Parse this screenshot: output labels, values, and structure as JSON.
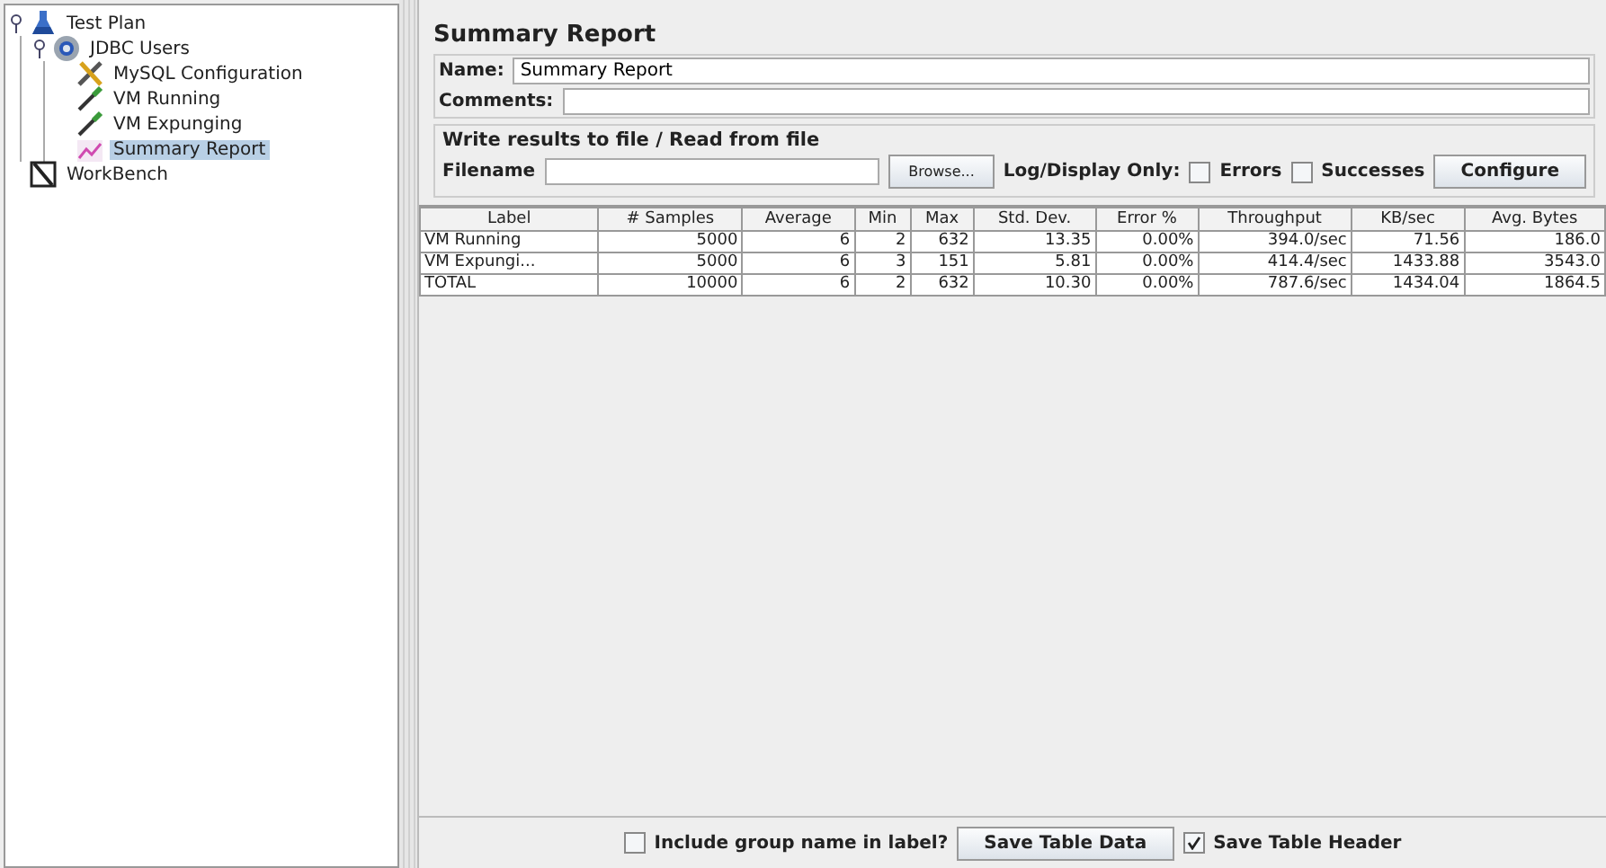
{
  "tree": [
    {
      "label": "Test Plan",
      "kind": "testplan",
      "selected": false,
      "expanded": true,
      "children": [
        {
          "label": "JDBC Users",
          "kind": "threadgroup",
          "selected": false,
          "expanded": true,
          "children": [
            {
              "label": "MySQL Configuration",
              "kind": "config",
              "selected": false
            },
            {
              "label": "VM Running",
              "kind": "sampler",
              "selected": false
            },
            {
              "label": "VM Expunging",
              "kind": "sampler",
              "selected": false
            },
            {
              "label": "Summary Report",
              "kind": "listener",
              "selected": true
            }
          ]
        }
      ]
    },
    {
      "label": "WorkBench",
      "kind": "workbench",
      "selected": false
    }
  ],
  "panel": {
    "title": "Summary Report",
    "name_label": "Name:",
    "name_value": "Summary Report",
    "comments_label": "Comments:",
    "file_group": {
      "title": "Write results to file / Read from file",
      "filename_label": "Filename",
      "browse": "Browse...",
      "log_label": "Log/Display Only:",
      "checks": [
        {
          "label": "Errors",
          "checked": false
        },
        {
          "label": "Successes",
          "checked": false
        }
      ],
      "configure": "Configure"
    }
  },
  "table": {
    "columns": [
      "Label",
      "# Samples",
      "Average",
      "Min",
      "Max",
      "Std. Dev.",
      "Error %",
      "Throughput",
      "KB/sec",
      "Avg. Bytes"
    ],
    "rows": [
      [
        "VM Running",
        "5000",
        "6",
        "2",
        "632",
        "13.35",
        "0.00%",
        "394.0/sec",
        "71.56",
        "186.0"
      ],
      [
        "VM Expungi...",
        "5000",
        "6",
        "3",
        "151",
        "5.81",
        "0.00%",
        "414.4/sec",
        "1433.88",
        "3543.0"
      ],
      [
        "TOTAL",
        "10000",
        "6",
        "2",
        "632",
        "10.30",
        "0.00%",
        "787.6/sec",
        "1434.04",
        "1864.5"
      ]
    ]
  },
  "footer": {
    "include_group": {
      "label": "Include group name in label?",
      "checked": false
    },
    "save_data": "Save Table Data",
    "save_header": {
      "label": "Save Table Header",
      "checked": true
    }
  }
}
